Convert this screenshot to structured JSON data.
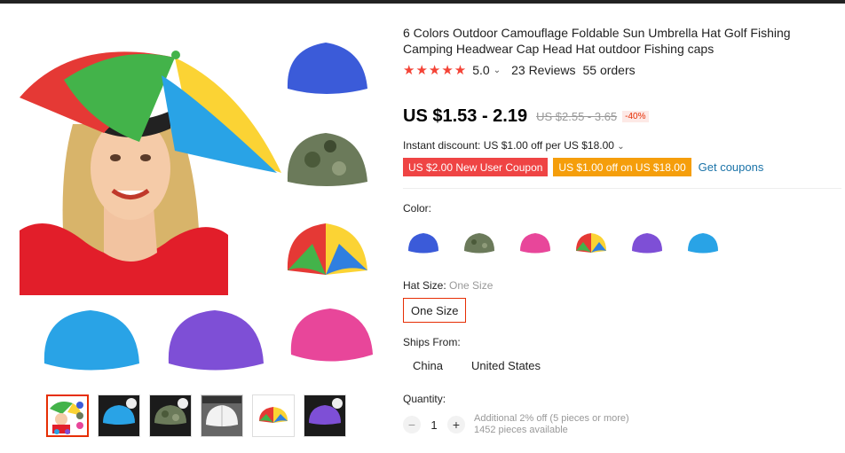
{
  "product": {
    "title": "6 Colors Outdoor Camouflage Foldable Sun Umbrella Hat Golf Fishing Camping Headwear Cap Head Hat outdoor Fishing caps",
    "rating_stars": "★★★★★",
    "rating_value": "5.0",
    "reviews": "23 Reviews",
    "orders": "55 orders"
  },
  "price": {
    "current": "US $1.53 - 2.19",
    "original": "US $2.55 - 3.65",
    "discount": "-40%"
  },
  "instant_discount": "Instant discount: US $1.00 off per US $18.00",
  "coupons": {
    "new_user": "US $2.00 New User Coupon",
    "off": "US $1.00 off on US $18.00",
    "get_link": "Get coupons"
  },
  "color": {
    "label": "Color:",
    "options": [
      "blue",
      "camouflage",
      "pink",
      "rainbow",
      "purple",
      "sky-blue"
    ],
    "colors": {
      "blue": "#3b5bd9",
      "camouflage": "#6b7a5a",
      "pink": "#e8469a",
      "purple": "#7e4fd6",
      "sky": "#29a3e6",
      "rainbow_red": "#e53935",
      "rainbow_yellow": "#fbd334",
      "rainbow_green": "#43b34a",
      "rainbow_blue": "#2f7fe0"
    }
  },
  "hat_size": {
    "label": "Hat Size:",
    "selected_label": "One Size",
    "option": "One Size"
  },
  "ships_from": {
    "label": "Ships From:",
    "options": [
      "China",
      "United States"
    ]
  },
  "quantity": {
    "label": "Quantity:",
    "value": "1",
    "minus": "−",
    "plus": "+",
    "bulk_note": "Additional 2% off (5 pieces or more)",
    "available": "1452 pieces available"
  },
  "gallery": {
    "thumbnails": [
      "collage",
      "sky-blue-umbrella",
      "camouflage-umbrella",
      "white-umbrella",
      "rainbow-umbrella",
      "purple-umbrella"
    ]
  }
}
